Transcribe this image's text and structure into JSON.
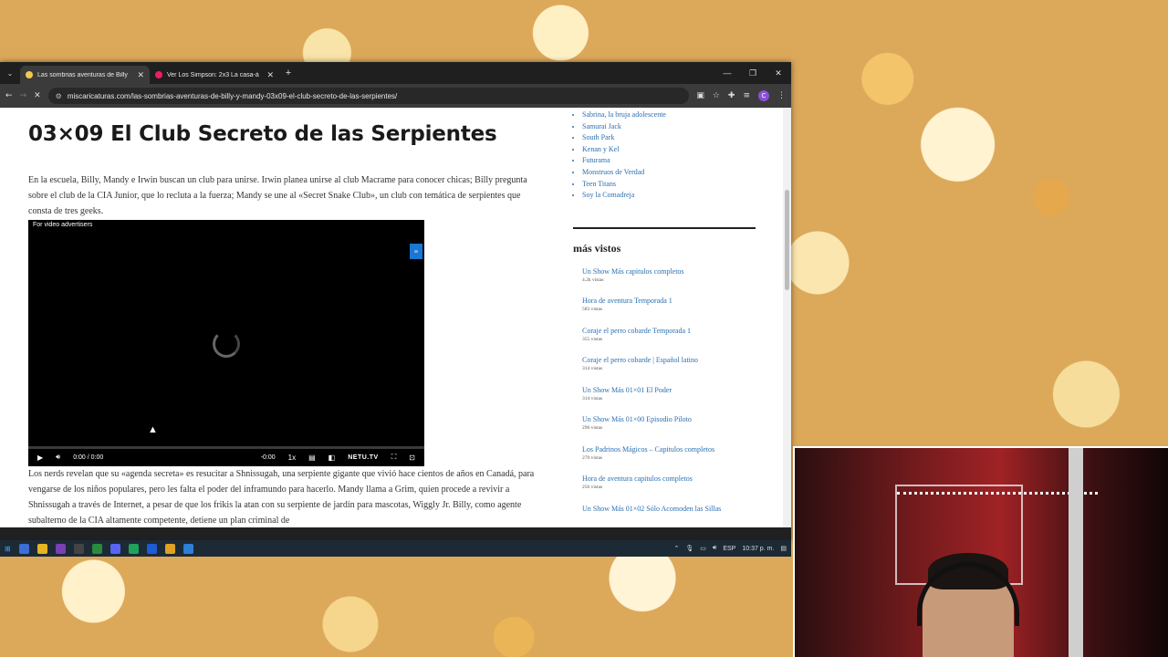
{
  "browser": {
    "tabs": [
      {
        "title": "Las sombrias aventuras de Billy",
        "favicon_color": "#f2c94c",
        "active": true
      },
      {
        "title": "Ver Los Simpson: 2x3 La casa-á",
        "favicon_color": "#e91e63",
        "active": false
      }
    ],
    "url": "miscaricaturas.com/las-sombrias-aventuras-de-billy-y-mandy-03x09-el-club-secreto-de-las-serpientes/",
    "profile_initial": "C"
  },
  "article": {
    "title": "03×09 El Club Secreto de las Serpientes",
    "intro": "En la escuela, Billy, Mandy e Irwin buscan un club para unirse. Irwin planea unirse al club Macrame para conocer chicas; Billy pregunta sobre el club de la CIA Junior, que lo recluta a la fuerza; Mandy se une al «Secret Snake Club», un club con temática de serpientes que consta de tres geeks.",
    "body": "Los nerds revelan que su «agenda secreta» es resucitar a Shnissugah, una serpiente gigante que vivió hace cientos de años en Canadá, para vengarse de los niños populares, pero les falta el poder del inframundo para hacerlo. Mandy llama a Grim, quien procede a revivir a Shnissugah a través de Internet, a pesar de que los frikis la atan con su serpiente de jardín para mascotas, Wiggly Jr. Billy, como agente subalterno de la CIA altamente competente, detiene un plan criminal de"
  },
  "player": {
    "advertiser_label": "For video advertisers",
    "time": "0:00 / 0:00",
    "remaining": "-0:00",
    "speed": "1x",
    "brand": "NETU.TV"
  },
  "sidebar": {
    "series": [
      "Sabrina, la bruja adolescente",
      "Samurai Jack",
      "South Park",
      "Kenan y Kel",
      "Futurama",
      "Monstruos de Verdad",
      "Teen Titans",
      "Soy la Comadreja"
    ],
    "most_viewed_title": "más vistos",
    "most_viewed": [
      {
        "title": "Un Show Más capitulos completos",
        "views": "4.2k vistas"
      },
      {
        "title": "Hora de aventura Temporada 1",
        "views": "583 vistas"
      },
      {
        "title": "Coraje el perro cobarde Temporada 1",
        "views": "355 vistas"
      },
      {
        "title": "Coraje el perro cobarde | Español latino",
        "views": "314 vistas"
      },
      {
        "title": "Un Show Más 01×01 El Poder",
        "views": "314 vistas"
      },
      {
        "title": "Un Show Más 01×00 Episodio Piloto",
        "views": "296 vistas"
      },
      {
        "title": "Los Padrinos Mágicos – Capitulos completos",
        "views": "270 vistas"
      },
      {
        "title": "Hora de aventura capitulos completos",
        "views": "256 vistas"
      },
      {
        "title": "Un Show Más 01×02 Sólo Acomoden las Sillas",
        "views": ""
      }
    ]
  },
  "taskbar": {
    "language": "ESP",
    "clock": "10:37 p. m."
  }
}
